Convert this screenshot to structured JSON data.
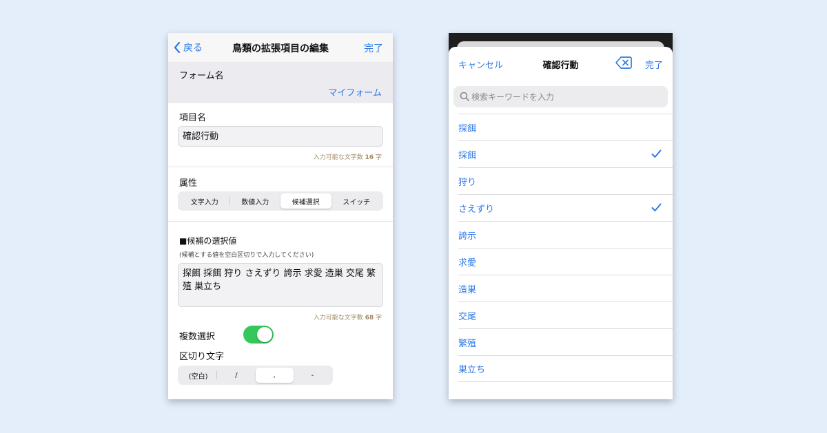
{
  "left": {
    "nav": {
      "back_label": "戻る",
      "title": "鳥類の拡張項目の編集",
      "done_label": "完了"
    },
    "form_name": {
      "label": "フォーム名",
      "value": "マイフォーム"
    },
    "item_name": {
      "label": "項目名",
      "value": "確認行動",
      "hint_prefix": "入力可能な文字数",
      "hint_count": "16",
      "hint_suffix": "字"
    },
    "attribute": {
      "label": "属性",
      "segments": [
        "文字入力",
        "数値入力",
        "候補選択",
        "スイッチ"
      ],
      "selected": "候補選択"
    },
    "candidates": {
      "heading": "■候補の選択値",
      "note": "(候補とする値を空白区切りで入力してください)",
      "value": "探餌 採餌 狩り さえずり 誇示 求愛 造巣 交尾 繁殖 巣立ち",
      "hint_prefix": "入力可能な文字数",
      "hint_count": "68",
      "hint_suffix": "字"
    },
    "multi_select": {
      "label": "複数選択",
      "on": true
    },
    "delimiter": {
      "label": "区切り文字",
      "segments": [
        "(空白)",
        "/",
        ",",
        "-"
      ],
      "selected": ","
    }
  },
  "right": {
    "cancel_label": "キャンセル",
    "title": "確認行動",
    "done_label": "完了",
    "search_placeholder": "検索キーワードを入力",
    "items": [
      {
        "label": "探餌",
        "checked": false
      },
      {
        "label": "採餌",
        "checked": true
      },
      {
        "label": "狩り",
        "checked": false
      },
      {
        "label": "さえずり",
        "checked": true
      },
      {
        "label": "誇示",
        "checked": false
      },
      {
        "label": "求愛",
        "checked": false
      },
      {
        "label": "造巣",
        "checked": false
      },
      {
        "label": "交尾",
        "checked": false
      },
      {
        "label": "繁殖",
        "checked": false
      },
      {
        "label": "巣立ち",
        "checked": false
      }
    ]
  },
  "colors": {
    "accent": "#2e7ae6",
    "toggle_on": "#34c759",
    "background": "#e3eefa",
    "hint": "#a08a64"
  },
  "icons": [
    "chevron-left-icon",
    "clear-input-icon",
    "search-icon",
    "checkmark-icon"
  ]
}
